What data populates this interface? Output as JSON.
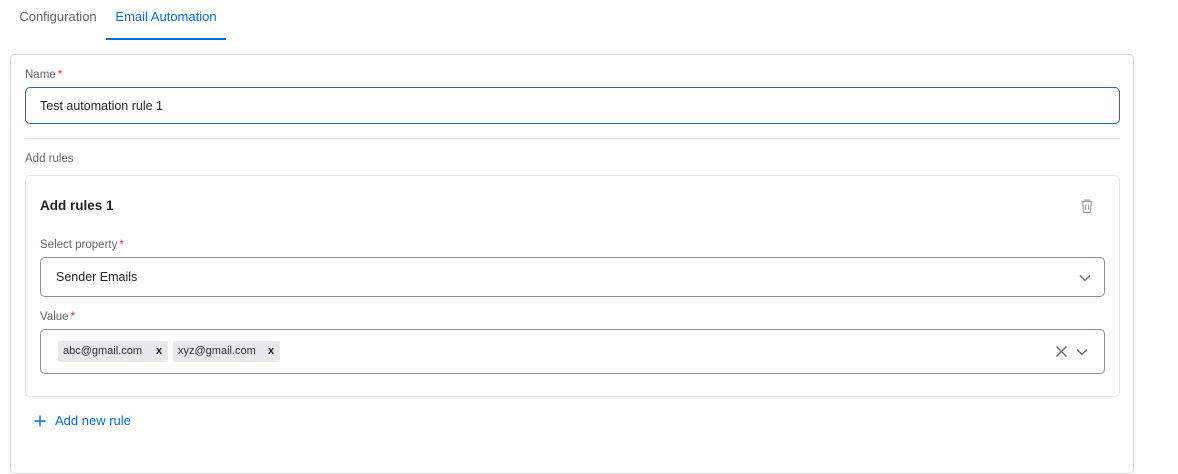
{
  "tabs": [
    {
      "label": "Configuration",
      "active": false
    },
    {
      "label": "Email Automation",
      "active": true
    }
  ],
  "form": {
    "name_label": "Name",
    "required_mark": "*",
    "name_value": "Test automation rule 1",
    "rules_section_label": "Add rules"
  },
  "rule": {
    "title": "Add rules 1",
    "property_label": "Select property",
    "property_value": "Sender Emails",
    "value_label": "Value",
    "values": [
      "abc@gmail.com",
      "xyz@gmail.com"
    ],
    "chip_remove_glyph": "x"
  },
  "actions": {
    "add_new_rule": "Add new rule"
  },
  "colors": {
    "accent": "#0a6bd6",
    "required": "#d92d2d",
    "input_focus_border": "#1f6f86"
  },
  "icons": {
    "delete": "trash-icon",
    "dropdown": "chevron-down-icon",
    "clear": "close-icon",
    "add": "plus-icon"
  }
}
